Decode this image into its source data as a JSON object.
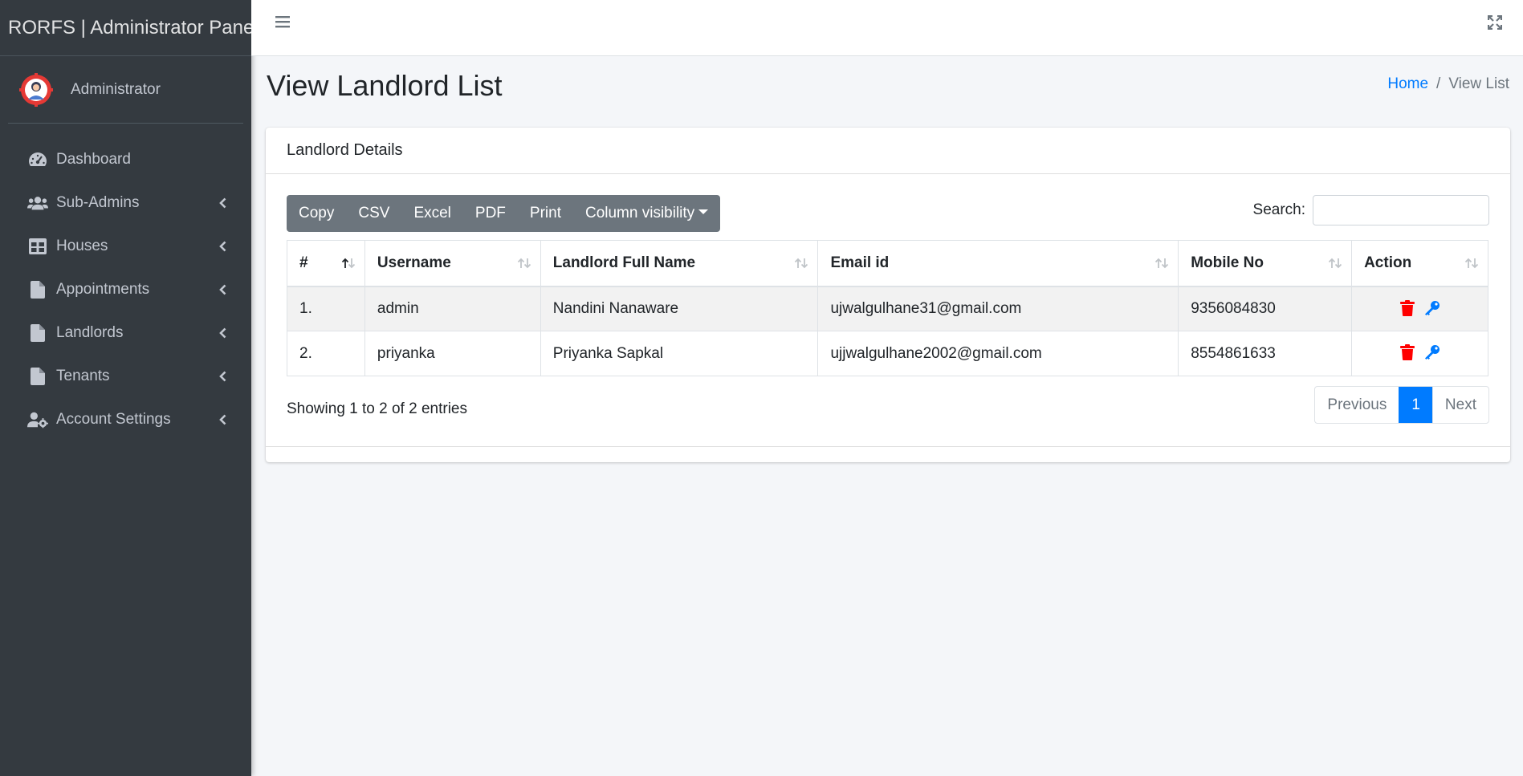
{
  "app": {
    "brand": "RORFS | Administrator Panel",
    "user_name": "Administrator"
  },
  "sidebar": {
    "items": [
      {
        "label": "Dashboard",
        "icon": "tachometer-icon",
        "has_submenu": false
      },
      {
        "label": "Sub-Admins",
        "icon": "users-icon",
        "has_submenu": true
      },
      {
        "label": "Houses",
        "icon": "table-icon",
        "has_submenu": true
      },
      {
        "label": "Appointments",
        "icon": "file-icon",
        "has_submenu": true
      },
      {
        "label": "Landlords",
        "icon": "file-icon",
        "has_submenu": true
      },
      {
        "label": "Tenants",
        "icon": "file-icon",
        "has_submenu": true
      },
      {
        "label": "Account Settings",
        "icon": "user-cog-icon",
        "has_submenu": true
      }
    ]
  },
  "header": {
    "page_title": "View Landlord List",
    "breadcrumb": {
      "home": "Home",
      "separator": "/",
      "current": "View List"
    }
  },
  "card": {
    "title": "Landlord Details",
    "buttons": [
      "Copy",
      "CSV",
      "Excel",
      "PDF",
      "Print",
      "Column visibility"
    ],
    "search": {
      "label": "Search:",
      "value": "",
      "placeholder": ""
    },
    "table": {
      "columns": [
        "#",
        "Username",
        "Landlord Full Name",
        "Email id",
        "Mobile No",
        "Action"
      ],
      "rows": [
        {
          "num": "1.",
          "username": "admin",
          "full_name": "Nandini Nanaware",
          "email": "ujwalgulhane31@gmail.com",
          "mobile": "9356084830"
        },
        {
          "num": "2.",
          "username": "priyanka",
          "full_name": "Priyanka Sapkal",
          "email": "ujjwalgulhane2002@gmail.com",
          "mobile": "8554861633"
        }
      ]
    },
    "info": "Showing 1 to 2 of 2 entries",
    "pagination": {
      "previous": "Previous",
      "page": "1",
      "next": "Next"
    }
  },
  "colors": {
    "sidebar_bg": "#343a40",
    "accent": "#007bff",
    "delete": "#ff0000",
    "button_bg": "#6c757d"
  }
}
